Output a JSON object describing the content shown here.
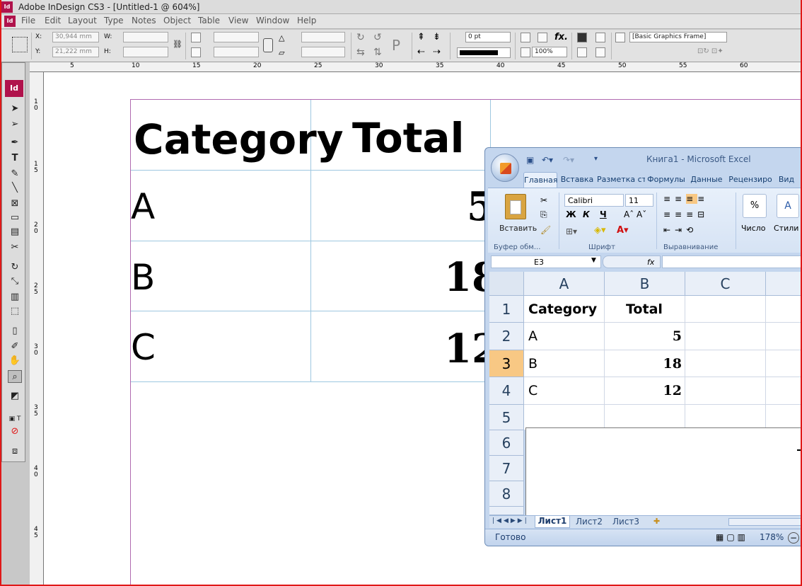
{
  "indesign": {
    "title": "Adobe InDesign CS3 - [Untitled-1 @ 604%]",
    "app_icon": "Id",
    "menu": [
      "File",
      "Edit",
      "Layout",
      "Type",
      "Notes",
      "Object",
      "Table",
      "View",
      "Window",
      "Help"
    ],
    "control": {
      "x_label": "X:",
      "x_value": "30,944 mm",
      "y_label": "Y:",
      "y_value": "21,222 mm",
      "w_label": "W:",
      "h_label": "H:",
      "stroke_weight": "0 pt",
      "opacity": "100%",
      "object_style": "[Basic Graphics Frame]"
    },
    "ruler_h": [
      "5",
      "10",
      "15",
      "20",
      "25",
      "30",
      "35",
      "40",
      "45",
      "50",
      "55",
      "60"
    ],
    "ruler_v": [
      "1\n0",
      "1\n5",
      "2\n0",
      "2\n5",
      "3\n0",
      "3\n5",
      "4\n0",
      "4\n5"
    ]
  },
  "doc_table": {
    "headers": [
      "Category",
      "Total"
    ],
    "rows": [
      [
        "A",
        "5"
      ],
      [
        "B",
        "18"
      ],
      [
        "C",
        "12"
      ]
    ]
  },
  "excel": {
    "title": "Книга1 - Microsoft Excel",
    "tabs": [
      "Главная",
      "Вставка",
      "Разметка ст",
      "Формулы",
      "Данные",
      "Рецензиро",
      "Вид"
    ],
    "paste_label": "Вставить",
    "font_name": "Calibri",
    "font_size": "11",
    "bold": "Ж",
    "italic": "К",
    "underline": "Ч",
    "number_label": "Число",
    "styles_label": "Стили",
    "groups": [
      "Буфер обм...",
      "Шрифт",
      "Выравнивание"
    ],
    "name_box": "E3",
    "fx": "fx",
    "columns": [
      "A",
      "B",
      "C"
    ],
    "rows": [
      "1",
      "2",
      "3",
      "4",
      "5",
      "6",
      "7",
      "8"
    ],
    "cells": [
      [
        "Category",
        "Total"
      ],
      [
        "A",
        "5"
      ],
      [
        "B",
        "18"
      ],
      [
        "C",
        "12"
      ]
    ],
    "sheets": [
      "Лист1",
      "Лист2",
      "Лист3"
    ],
    "status": "Готово",
    "zoom": "178%",
    "colors": {
      "ribbon": "#c4d6ee",
      "selected_row": "#f8c884"
    }
  }
}
